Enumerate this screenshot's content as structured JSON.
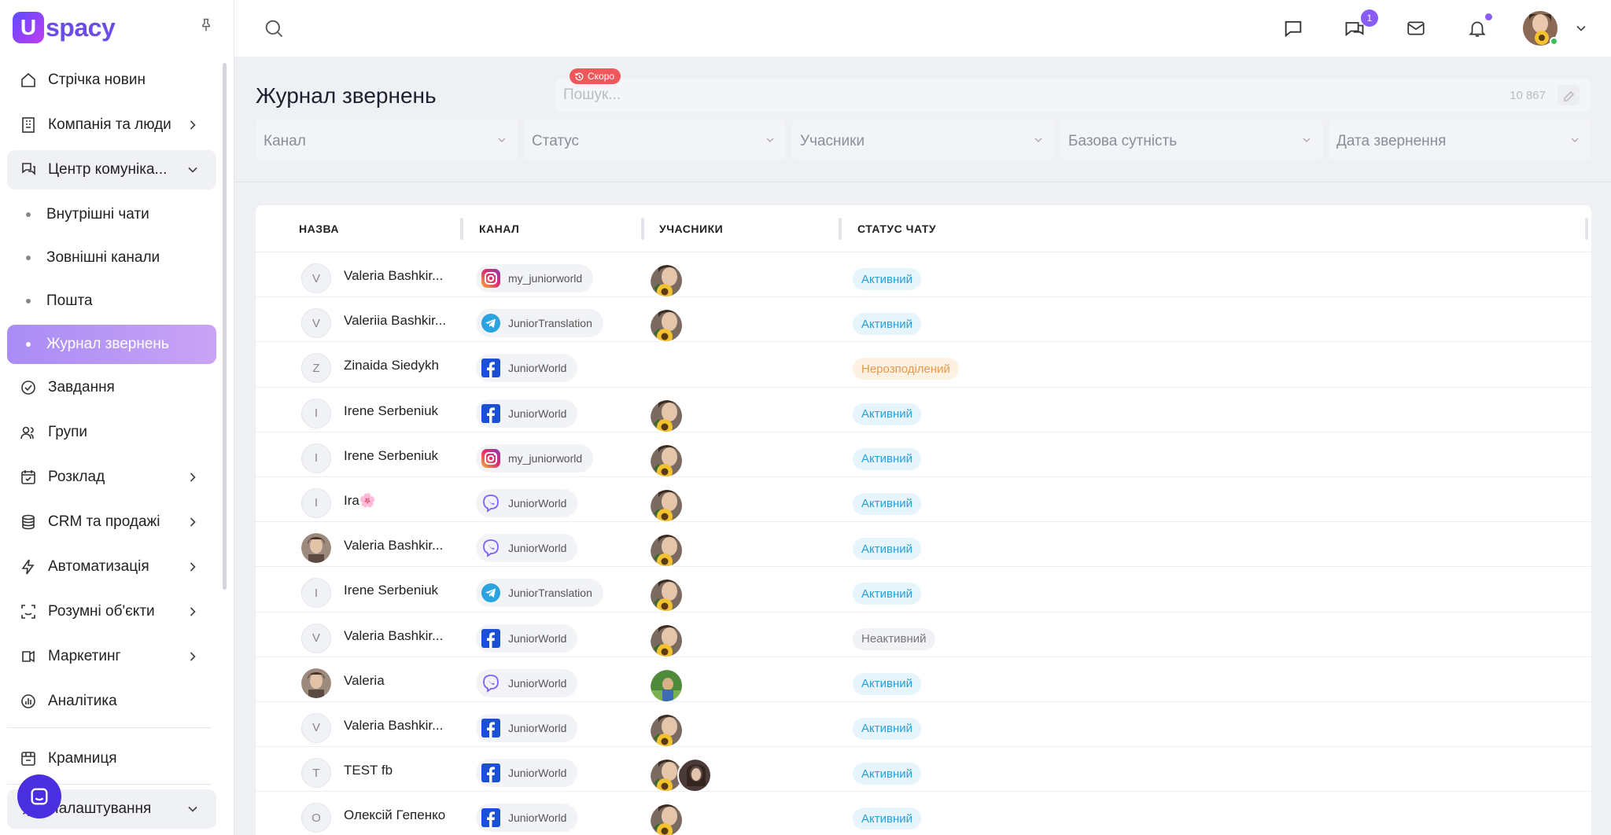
{
  "brand": {
    "mark": "U",
    "name": "spacy"
  },
  "sidebar": {
    "items": [
      {
        "label": "Стрічка новин",
        "icon": "home-icon"
      },
      {
        "label": "Компанія та люди",
        "icon": "company-icon"
      },
      {
        "label": "Центр комуніка...",
        "icon": "communication-icon"
      }
    ],
    "sub_items": [
      {
        "label": "Внутрішні чати"
      },
      {
        "label": "Зовнішні канали"
      },
      {
        "label": "Пошта"
      },
      {
        "label": "Журнал звернень"
      }
    ],
    "items2": [
      {
        "label": "Завдання",
        "icon": "tasks-icon"
      },
      {
        "label": "Групи",
        "icon": "groups-icon"
      },
      {
        "label": "Розклад",
        "icon": "calendar-icon"
      },
      {
        "label": "CRM та продажі",
        "icon": "crm-icon"
      },
      {
        "label": "Автоматизація",
        "icon": "automation-icon"
      },
      {
        "label": "Розумні об'єкти",
        "icon": "smart-objects-icon"
      },
      {
        "label": "Маркетинг",
        "icon": "marketing-icon"
      },
      {
        "label": "Аналітика",
        "icon": "analytics-icon"
      }
    ],
    "store_label": "Крамниця",
    "settings_label": "Налаштування"
  },
  "topbar": {
    "messages_badge": "1"
  },
  "page": {
    "title": "Журнал звернень",
    "soon_label": "Скоро",
    "search_placeholder": "Пошук...",
    "total_count": "10 867"
  },
  "filters": [
    "Канал",
    "Статус",
    "Учасники",
    "Базова сутність",
    "Дата звернення"
  ],
  "table": {
    "columns": [
      "НАЗВА",
      "КАНАЛ",
      "УЧАСНИКИ",
      "СТАТУС ЧАТУ"
    ],
    "rows": [
      {
        "initial": "V",
        "photo": false,
        "name": "Valeria Bashkir...",
        "channel_type": "instagram",
        "channel": "my_juniorworld",
        "participants": [
          "sunflower"
        ],
        "status": "Активний",
        "status_kind": "active"
      },
      {
        "initial": "V",
        "photo": false,
        "name": "Valeriia Bashkir...",
        "channel_type": "telegram",
        "channel": "JuniorTranslation",
        "participants": [
          "sunflower"
        ],
        "status": "Активний",
        "status_kind": "active"
      },
      {
        "initial": "Z",
        "photo": false,
        "name": "Zinaida Siedykh",
        "channel_type": "facebook",
        "channel": "JuniorWorld",
        "participants": [],
        "status": "Нерозподілений",
        "status_kind": "unassigned"
      },
      {
        "initial": "I",
        "photo": false,
        "name": "Irene Serbeniuk",
        "channel_type": "facebook",
        "channel": "JuniorWorld",
        "participants": [
          "sunflower"
        ],
        "status": "Активний",
        "status_kind": "active"
      },
      {
        "initial": "I",
        "photo": false,
        "name": "Irene Serbeniuk",
        "channel_type": "instagram",
        "channel": "my_juniorworld",
        "participants": [
          "sunflower"
        ],
        "status": "Активний",
        "status_kind": "active"
      },
      {
        "initial": "I",
        "photo": false,
        "name": "Ira🌸",
        "channel_type": "viber",
        "channel": "JuniorWorld",
        "participants": [
          "sunflower"
        ],
        "status": "Активний",
        "status_kind": "active"
      },
      {
        "initial": "",
        "photo": true,
        "name": "Valeria Bashkir...",
        "channel_type": "viber",
        "channel": "JuniorWorld",
        "participants": [
          "sunflower"
        ],
        "status": "Активний",
        "status_kind": "active"
      },
      {
        "initial": "I",
        "photo": false,
        "name": "Irene Serbeniuk",
        "channel_type": "telegram",
        "channel": "JuniorTranslation",
        "participants": [
          "sunflower"
        ],
        "status": "Активний",
        "status_kind": "active"
      },
      {
        "initial": "V",
        "photo": false,
        "name": "Valeria Bashkir...",
        "channel_type": "facebook",
        "channel": "JuniorWorld",
        "participants": [
          "sunflower"
        ],
        "status": "Неактивний",
        "status_kind": "inactive"
      },
      {
        "initial": "",
        "photo": true,
        "name": "Valeria",
        "channel_type": "viber",
        "channel": "JuniorWorld",
        "participants": [
          "green"
        ],
        "status": "Активний",
        "status_kind": "active"
      },
      {
        "initial": "V",
        "photo": false,
        "name": "Valeria Bashkir...",
        "channel_type": "facebook",
        "channel": "JuniorWorld",
        "participants": [
          "sunflower"
        ],
        "status": "Активний",
        "status_kind": "active"
      },
      {
        "initial": "T",
        "photo": false,
        "name": "TEST fb",
        "channel_type": "facebook",
        "channel": "JuniorWorld",
        "participants": [
          "sunflower",
          "dark"
        ],
        "status": "Активний",
        "status_kind": "active"
      },
      {
        "initial": "O",
        "photo": false,
        "name": "Олексій Гепенко",
        "channel_type": "facebook",
        "channel": "JuniorWorld",
        "participants": [
          "sunflower"
        ],
        "status": "Активний",
        "status_kind": "active"
      }
    ]
  },
  "colors": {
    "accent": "#8a5cf6",
    "active_status": "#2a9fd6",
    "unassigned_status": "#e49a4a"
  }
}
